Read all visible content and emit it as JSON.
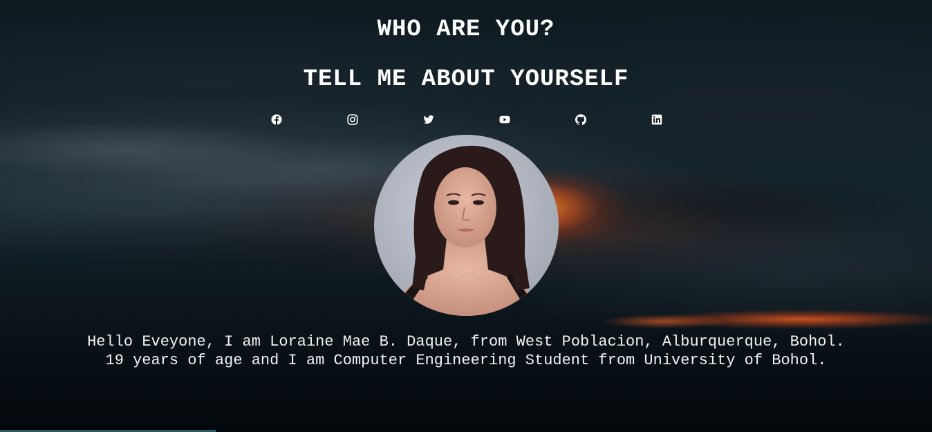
{
  "header": {
    "title": "WHO ARE YOU?",
    "subtitle": "TELL ME ABOUT YOURSELF"
  },
  "social_links": [
    {
      "name": "facebook",
      "icon": "facebook-icon"
    },
    {
      "name": "instagram",
      "icon": "instagram-icon"
    },
    {
      "name": "twitter",
      "icon": "twitter-icon"
    },
    {
      "name": "youtube",
      "icon": "youtube-icon"
    },
    {
      "name": "github",
      "icon": "github-icon"
    },
    {
      "name": "linkedin",
      "icon": "linkedin-icon"
    }
  ],
  "profile": {
    "photo": "profile-photo"
  },
  "bio": {
    "text": "Hello Eveyone, I am Loraine Mae B. Daque, from West Poblacion, Alburquerque, Bohol. 19 years of age and I am Computer Engineering Student from University of Bohol."
  },
  "colors": {
    "text": "#ffffff",
    "background_dark": "#050b10",
    "sunset_orange": "#e8681f"
  }
}
